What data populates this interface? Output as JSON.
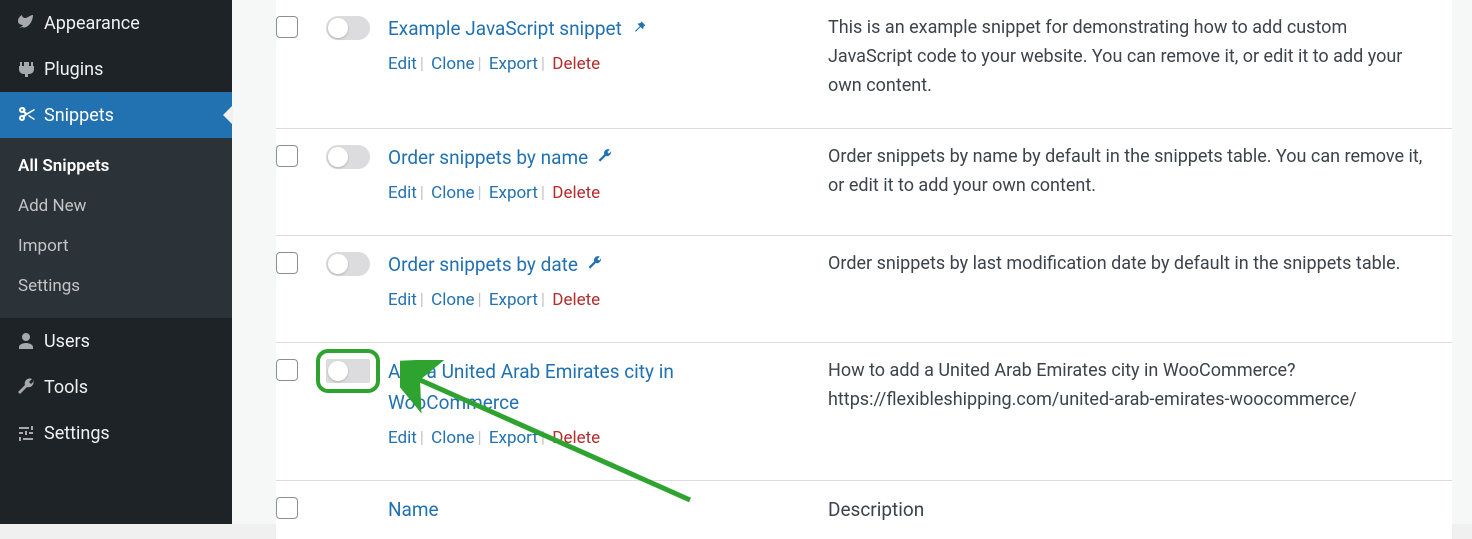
{
  "sidebar": {
    "items": [
      {
        "id": "appearance",
        "label": "Appearance"
      },
      {
        "id": "plugins",
        "label": "Plugins"
      },
      {
        "id": "snippets",
        "label": "Snippets"
      },
      {
        "id": "users",
        "label": "Users"
      },
      {
        "id": "tools",
        "label": "Tools"
      },
      {
        "id": "settings",
        "label": "Settings"
      }
    ],
    "submenu": {
      "items": [
        {
          "id": "all-snippets",
          "label": "All Snippets"
        },
        {
          "id": "add-new",
          "label": "Add New"
        },
        {
          "id": "import",
          "label": "Import"
        },
        {
          "id": "settings",
          "label": "Settings"
        }
      ]
    }
  },
  "actions": {
    "edit": "Edit",
    "clone": "Clone",
    "export": "Export",
    "delete": "Delete"
  },
  "columns": {
    "name": "Name",
    "description": "Description"
  },
  "snippets": [
    {
      "title": "Example JavaScript snippet",
      "icon": "pin",
      "description": "This is an example snippet for demonstrating how to add custom JavaScript code to your website. You can remove it, or edit it to add your own content."
    },
    {
      "title": "Order snippets by name",
      "icon": "wrench",
      "description": "Order snippets by name by default in the snippets table. You can remove it, or edit it to add your own content."
    },
    {
      "title": "Order snippets by date",
      "icon": "wrench",
      "description": "Order snippets by last modification date by default in the snippets table."
    },
    {
      "title": "Add a United Arab Emirates city in WooCommerce",
      "icon": "",
      "highlight": true,
      "description": "How to add a United Arab Emirates city in WooCommerce? https://flexibleshipping.com/united-arab-emirates-woocommerce/"
    }
  ]
}
